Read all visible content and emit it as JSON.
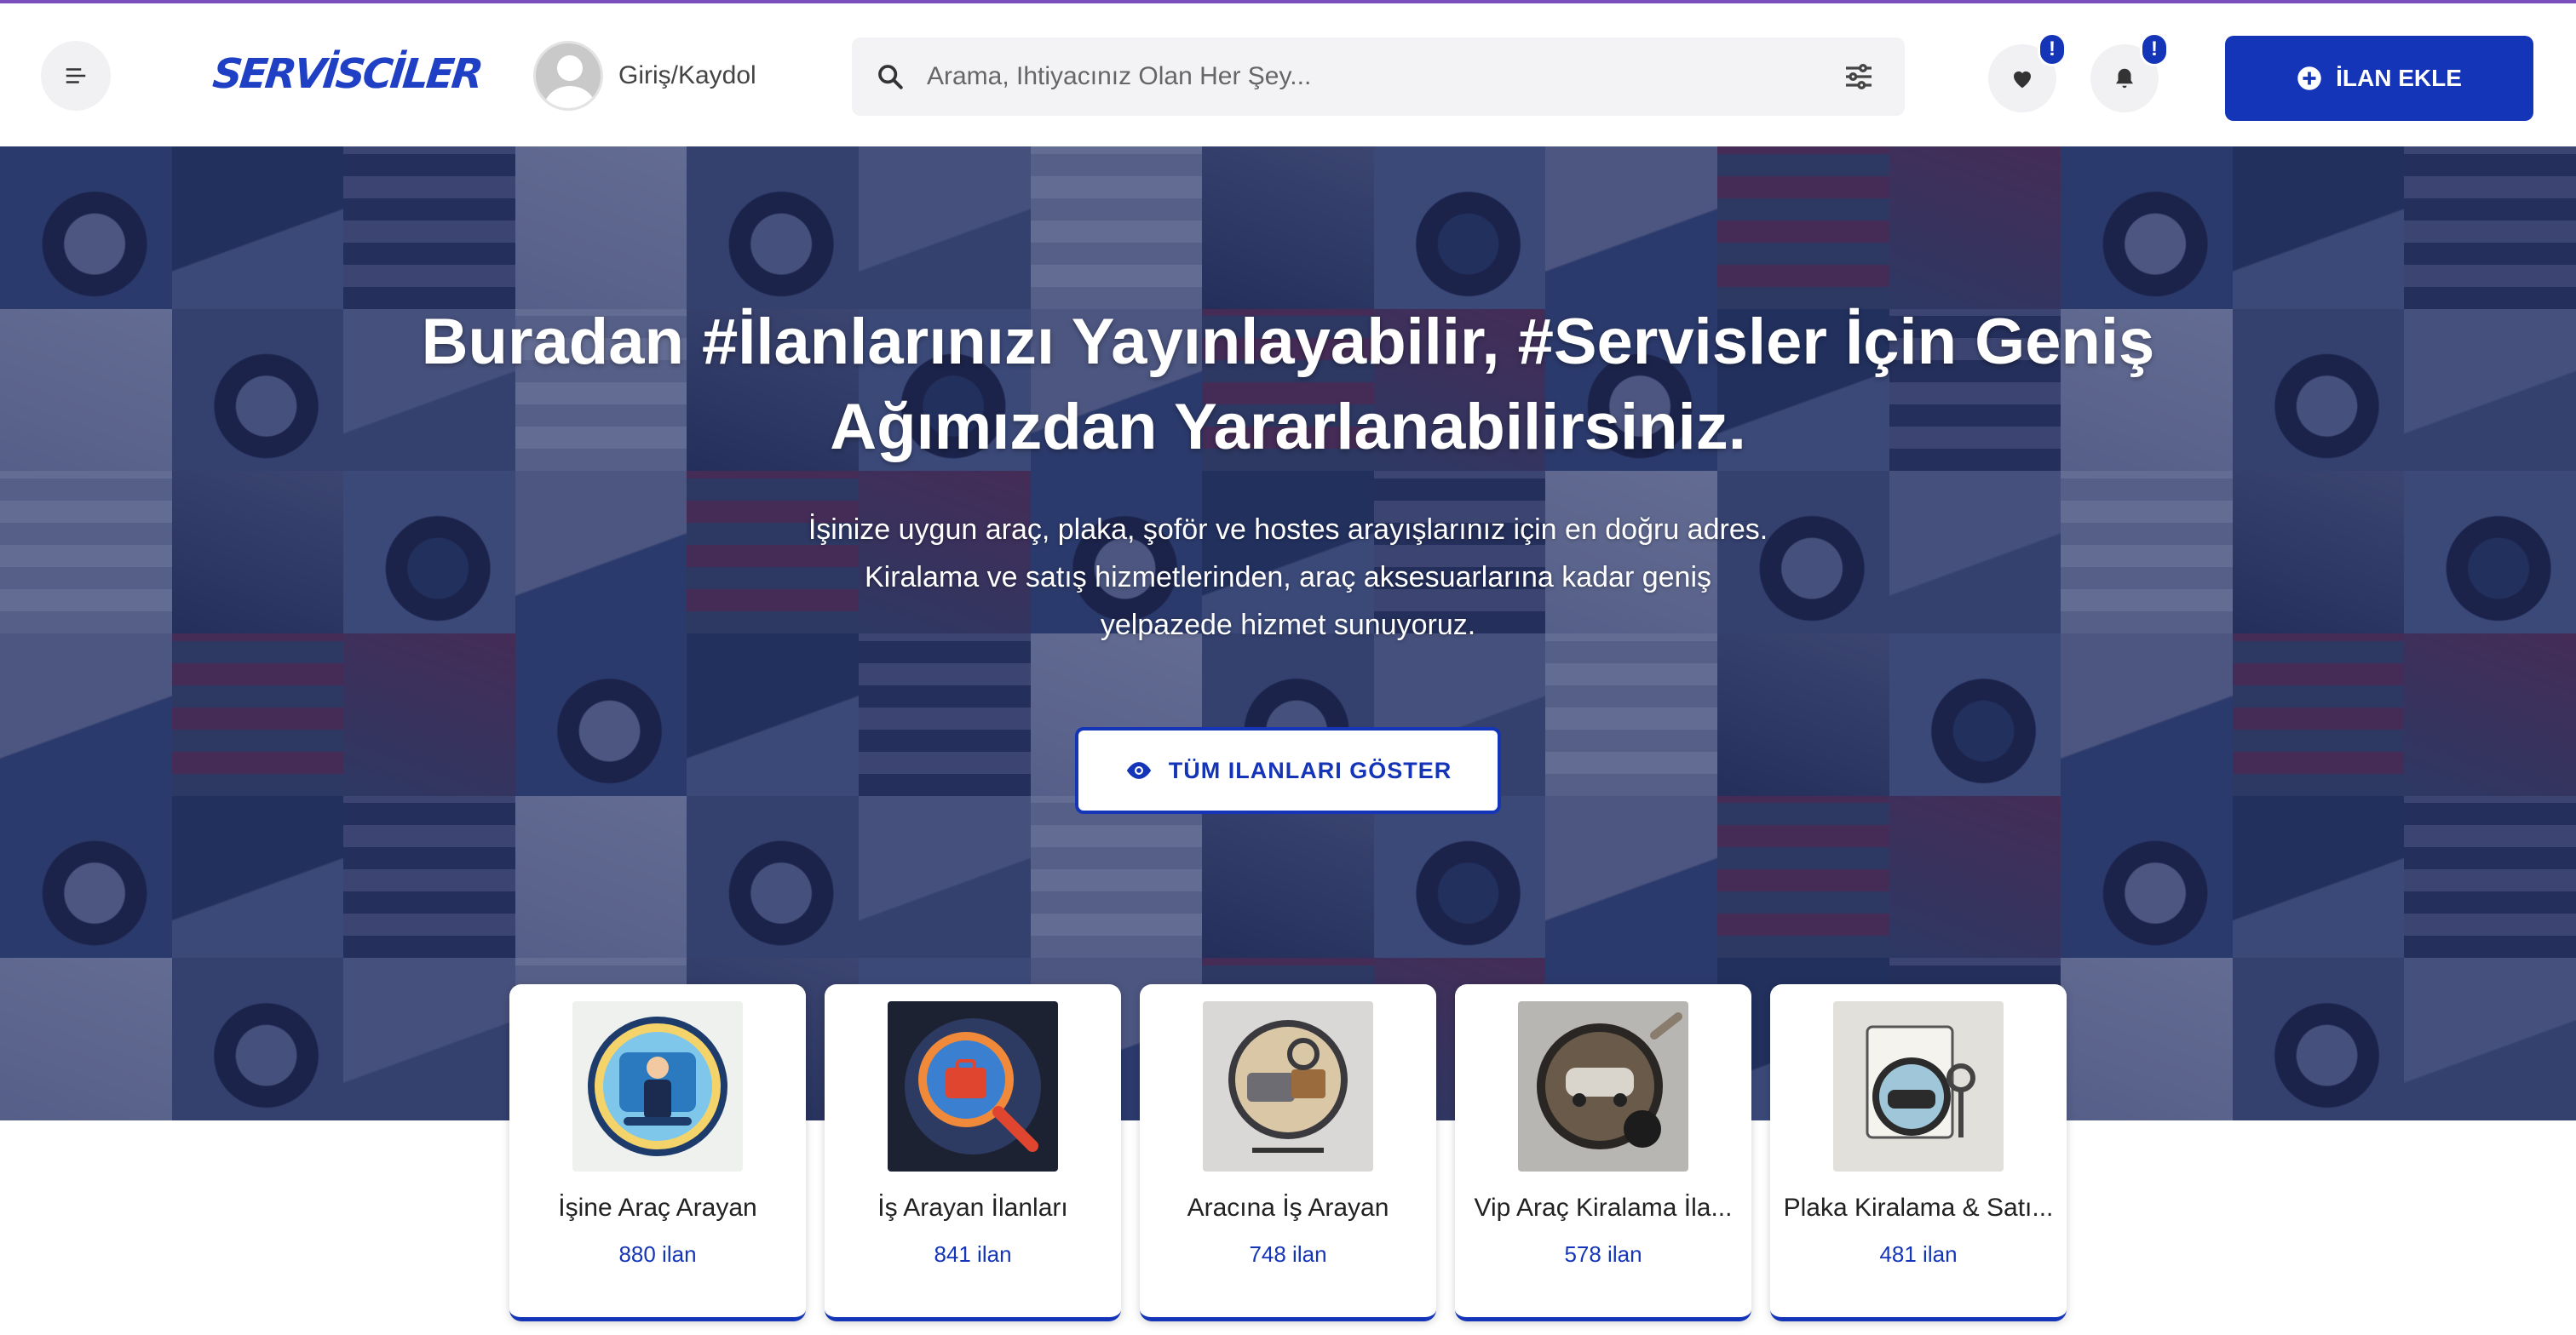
{
  "header": {
    "logo_text": "SERVİSCİLER",
    "login_label": "Giriş/Kaydol",
    "search_placeholder": "Arama, Ihtiyacınız Olan Her Şey...",
    "favorites_badge": "!",
    "notifications_badge": "!",
    "add_button_label": "İLAN EKLE"
  },
  "hero": {
    "title_line1": "Buradan #İlanlarınızı Yayınlayabilir, #Servisler İçin Geniş",
    "title_line2": "Ağımızdan Yararlanabilirsiniz.",
    "desc_line1": "İşinize uygun araç, plaka, şoför ve hostes arayışlarınız için en doğru adres.",
    "desc_line2": "Kiralama ve satış hizmetlerinden, araç aksesuarlarına kadar geniş",
    "desc_line3": "yelpazede hizmet sunuyoruz.",
    "show_all_label": "TÜM ILANLARI GÖSTER"
  },
  "categories": [
    {
      "title": "İşine Araç Arayan",
      "count": "880 ilan",
      "icon": "driver-badge-icon"
    },
    {
      "title": "İş Arayan İlanları",
      "count": "841 ilan",
      "icon": "briefcase-search-icon"
    },
    {
      "title": "Aracına İş Arayan",
      "count": "748 ilan",
      "icon": "van-briefcase-icon"
    },
    {
      "title": "Vip Araç Kiralama İla...",
      "count": "578 ilan",
      "icon": "vip-car-key-icon"
    },
    {
      "title": "Plaka Kiralama & Satı...",
      "count": "481 ilan",
      "icon": "plate-keys-icon"
    }
  ],
  "colors": {
    "brand_blue": "#1535b8",
    "hero_overlay": "#1c2a78",
    "top_accent": "#7a4fbd"
  }
}
